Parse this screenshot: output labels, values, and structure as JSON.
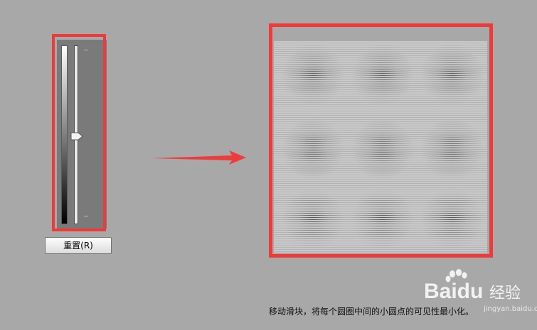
{
  "reset_button": {
    "label": "重置(R)"
  },
  "caption": "移动滑块，将每个圆圈中间的小圆点的可见性最小化。",
  "watermark": {
    "brand": "Baidu",
    "suffix": "经验",
    "sub": "jingyan.baidu.com"
  },
  "slider": {
    "level": 0.51
  },
  "colors": {
    "highlight": "#f03a3a",
    "background": "#a8a8a8",
    "panel": "#7a7a7a"
  },
  "icons": {
    "arrow": "right-arrow-icon",
    "thumb": "slider-thumb-icon",
    "logo": "baidu-paw-logo"
  }
}
